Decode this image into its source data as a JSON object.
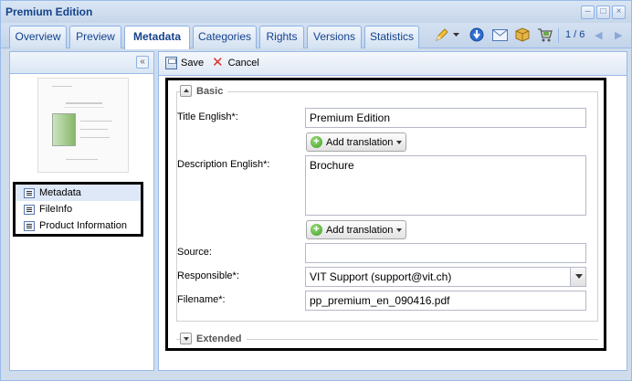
{
  "window": {
    "title": "Premium Edition",
    "tools": {
      "minimize": "–",
      "maximize": "□",
      "close": "×"
    }
  },
  "tabs": [
    {
      "label": "Overview",
      "active": false
    },
    {
      "label": "Preview",
      "active": false
    },
    {
      "label": "Metadata",
      "active": true
    },
    {
      "label": "Categories",
      "active": false
    },
    {
      "label": "Rights",
      "active": false
    },
    {
      "label": "Versions",
      "active": false
    },
    {
      "label": "Statistics",
      "active": false
    }
  ],
  "toolbar_icons": [
    "pencil-icon",
    "dropdown-arrow-icon",
    "download-icon",
    "mail-icon",
    "package-icon",
    "cart-icon"
  ],
  "pager": {
    "text": "1 / 6",
    "prev": "◀",
    "next": "▶"
  },
  "left_panel": {
    "collapse": "«",
    "tree": [
      {
        "label": "Metadata",
        "selected": true
      },
      {
        "label": "FileInfo",
        "selected": false
      },
      {
        "label": "Product Information",
        "selected": false
      }
    ]
  },
  "form_toolbar": {
    "save_label": "Save",
    "cancel_label": "Cancel"
  },
  "form": {
    "basic_legend": "Basic",
    "extended_legend": "Extended",
    "title_label": "Title English*:",
    "title_value": "Premium Edition",
    "add_translation": "Add translation",
    "description_label": "Description English*:",
    "description_value": "Brochure",
    "source_label": "Source:",
    "source_value": "",
    "responsible_label": "Responsible*:",
    "responsible_value": "VIT Support (support@vit.ch)",
    "filename_label": "Filename*:",
    "filename_value": "pp_premium_en_090416.pdf"
  },
  "colors": {
    "accent": "#15428b",
    "border": "#99bbe8",
    "highlight_frame": "#000000"
  }
}
